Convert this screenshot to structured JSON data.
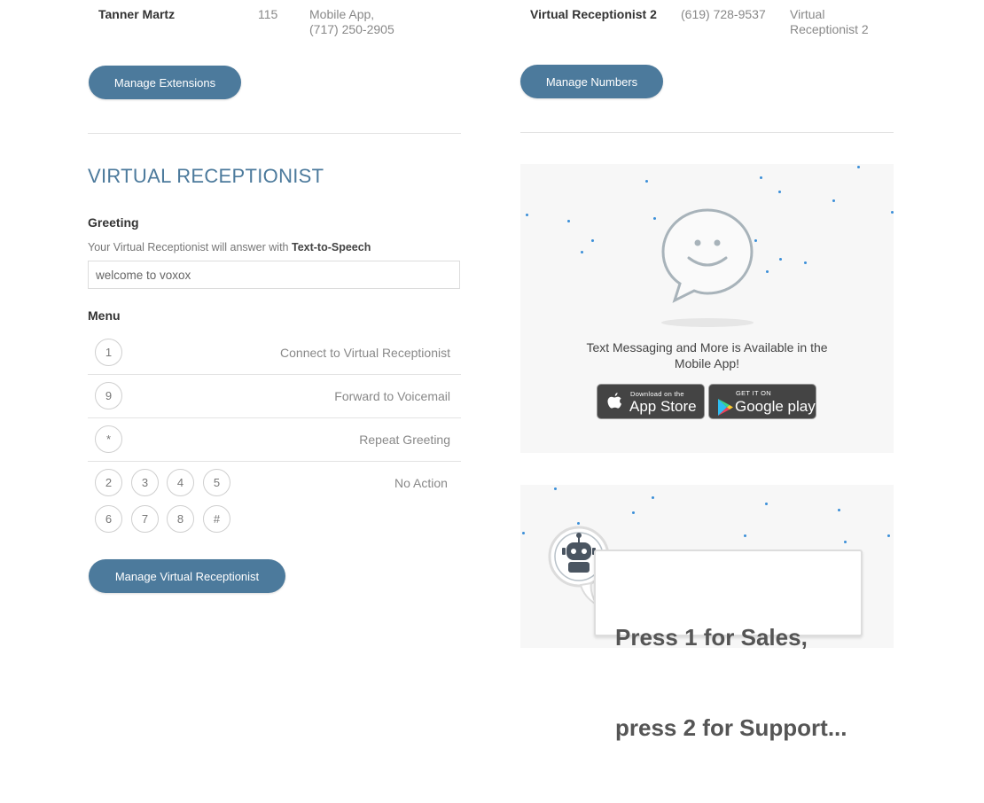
{
  "extensions": {
    "row": {
      "name": "Tanner Martz",
      "extension": "115",
      "device_line1": "Mobile App,",
      "device_line2": "(717) 250-2905"
    },
    "manage_button": "Manage Extensions"
  },
  "numbers": {
    "row": {
      "name": "Virtual Receptionist 2",
      "phone": "(619) 728-9537",
      "dest_line1": "Virtual",
      "dest_line2": "Receptionist 2"
    },
    "manage_button": "Manage Numbers"
  },
  "virtual_receptionist": {
    "title": "VIRTUAL RECEPTIONIST",
    "greeting_label": "Greeting",
    "greeting_hint_prefix": "Your Virtual Receptionist will answer with",
    "greeting_hint_bold": "Text-to-Speech",
    "greeting_value": "welcome to voxox",
    "menu_label": "Menu",
    "menu_rows": [
      {
        "key": "1",
        "action": "Connect to Virtual Receptionist"
      },
      {
        "key": "9",
        "action": "Forward to Voicemail"
      },
      {
        "key": "*",
        "action": "Repeat Greeting"
      }
    ],
    "no_action_keys": [
      "2",
      "3",
      "4",
      "5",
      "6",
      "7",
      "8",
      "#"
    ],
    "no_action_label": "No Action",
    "manage_button": "Manage Virtual Receptionist"
  },
  "promo": {
    "text_line1": "Text Messaging and More is Available in the",
    "text_line2": "Mobile App!",
    "app_store": {
      "small": "Download on the",
      "big": "App Store"
    },
    "google_play": {
      "small": "GET IT ON",
      "big": "Google play"
    },
    "icon": "smiley-chat-bubble-icon"
  },
  "ivr_promo": {
    "icon": "robot-icon",
    "line1": "Press 1 for Sales,",
    "line2": "press 2 for Support..."
  },
  "colors": {
    "accent": "#4c7a9c",
    "panel": "#f7f7f7",
    "dots": "#3b8fd8"
  }
}
